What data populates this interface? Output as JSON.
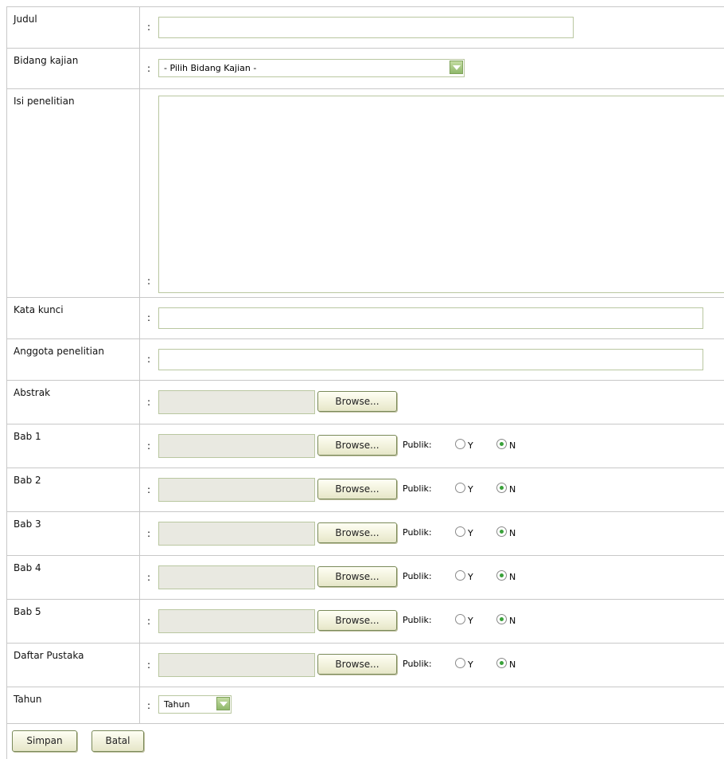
{
  "form": {
    "colon": ":",
    "judul": {
      "label": "Judul",
      "value": ""
    },
    "bidang_kajian": {
      "label": "Bidang kajian",
      "selected": "- Pilih Bidang Kajian -"
    },
    "isi_penelitian": {
      "label": "Isi penelitian",
      "value": ""
    },
    "kata_kunci": {
      "label": "Kata kunci",
      "value": ""
    },
    "anggota_penelitian": {
      "label": "Anggota penelitian",
      "value": ""
    },
    "abstrak": {
      "label": "Abstrak"
    },
    "browse_label": "Browse...",
    "publik_label": "Publik:",
    "radio_y": "Y",
    "radio_n": "N",
    "bab_rows": [
      {
        "label": "Bab 1",
        "publik": "N"
      },
      {
        "label": "Bab 2",
        "publik": "N"
      },
      {
        "label": "Bab 3",
        "publik": "N"
      },
      {
        "label": "Bab 4",
        "publik": "N"
      },
      {
        "label": "Bab 5",
        "publik": "N"
      },
      {
        "label": "Daftar Pustaka",
        "publik": "N"
      }
    ],
    "tahun": {
      "label": "Tahun",
      "selected": "Tahun"
    }
  },
  "buttons": {
    "simpan": "Simpan",
    "batal": "Batal"
  }
}
